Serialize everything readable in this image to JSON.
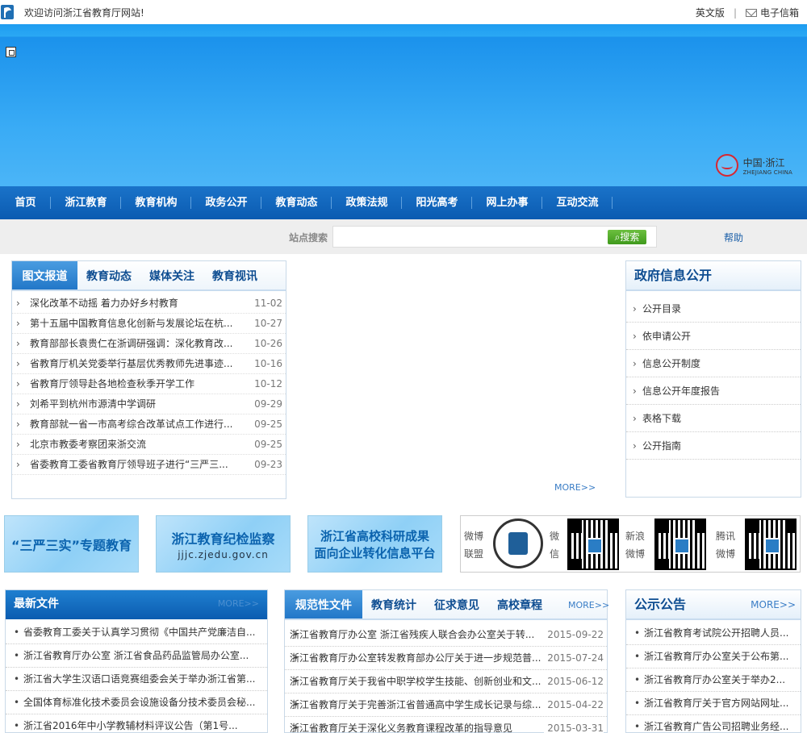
{
  "topbar": {
    "welcome": "欢迎访问浙江省教育厅网站!",
    "english": "英文版",
    "separator": "|",
    "mail": "电子信箱"
  },
  "banner": {
    "logo_cn": "中国·浙江",
    "logo_en": "ZHEJIANG CHINA"
  },
  "nav": {
    "items": [
      "首页",
      "浙江教育",
      "教育机构",
      "政务公开",
      "教育动态",
      "政策法规",
      "阳光高考",
      "网上办事",
      "互动交流"
    ]
  },
  "search": {
    "label": "站点搜索",
    "button": "搜索",
    "help": "帮助"
  },
  "news_panel": {
    "tabs": [
      "图文报道",
      "教育动态",
      "媒体关注",
      "教育视讯"
    ],
    "items": [
      {
        "title": "深化改革不动摇 着力办好乡村教育",
        "date": "11-02"
      },
      {
        "title": "第十五届中国教育信息化创新与发展论坛在杭...",
        "date": "10-27"
      },
      {
        "title": "教育部部长袁贵仁在浙调研强调：深化教育改...",
        "date": "10-26"
      },
      {
        "title": "省教育厅机关党委举行基层优秀教师先进事迹...",
        "date": "10-16"
      },
      {
        "title": "省教育厅领导赴各地检查秋季开学工作",
        "date": "10-12"
      },
      {
        "title": "刘希平到杭州市源清中学调研",
        "date": "09-29"
      },
      {
        "title": "教育部就一省一市高考综合改革试点工作进行...",
        "date": "09-25"
      },
      {
        "title": "北京市教委考察团来浙交流",
        "date": "09-25"
      },
      {
        "title": "省委教育工委省教育厅领导班子进行“三严三...",
        "date": "09-23"
      }
    ],
    "more": "MORE>>"
  },
  "gov_panel": {
    "title": "政府信息公开",
    "items": [
      "公开目录",
      "依申请公开",
      "信息公开制度",
      "信息公开年度报告",
      "表格下载",
      "公开指南"
    ]
  },
  "promos": [
    {
      "line1": "“三严三实”专题教育",
      "line2": ""
    },
    {
      "line1": "浙江教育纪检监察",
      "line2": "jjjc.zjedu.gov.cn"
    },
    {
      "line1": "浙江省高校科研成果",
      "line2": "面向企业转化信息平台"
    }
  ],
  "weibo": {
    "label1": "微博联盟",
    "label2": "微信",
    "label3": "新浪微博",
    "label4": "腾讯微博"
  },
  "latest": {
    "title": "最新文件",
    "more": "MORE>>",
    "items": [
      "省委教育工委关于认真学习贯彻《中国共产党廉洁自...",
      "浙江省教育厅办公室 浙江省食品药品监管局办公室...",
      "浙江省大学生汉语口语竞赛组委会关于举办浙江省第...",
      "全国体育标准化技术委员会设施设备分技术委员会秘...",
      "浙江省2016年中小学教辅材料评议公告（第1号..."
    ]
  },
  "docs": {
    "tabs": [
      "规范性文件",
      "教育统计",
      "征求意见",
      "高校章程"
    ],
    "more": "MORE>>",
    "items": [
      {
        "title": "浙江省教育厅办公室 浙江省残疾人联合会办公室关于转...",
        "date": "2015-09-22"
      },
      {
        "title": "浙江省教育厅办公室转发教育部办公厅关于进一步规范普...",
        "date": "2015-07-24"
      },
      {
        "title": "浙江省教育厅关于我省中职学校学生技能、创新创业和文...",
        "date": "2015-06-12"
      },
      {
        "title": "浙江省教育厅关于完善浙江省普通高中学生成长记录与综...",
        "date": "2015-04-22"
      },
      {
        "title": "浙江省教育厅关于深化义务教育课程改革的指导意见",
        "date": "2015-03-31"
      }
    ]
  },
  "notice": {
    "title": "公示公告",
    "more": "MORE>>",
    "items": [
      "浙江省教育考试院公开招聘人员...",
      "浙江省教育厅办公室关于公布第...",
      "浙江省教育厅办公室关于举办2...",
      "浙江省教育厅关于官方网站网址...",
      "浙江省教育广告公司招聘业务经..."
    ]
  }
}
